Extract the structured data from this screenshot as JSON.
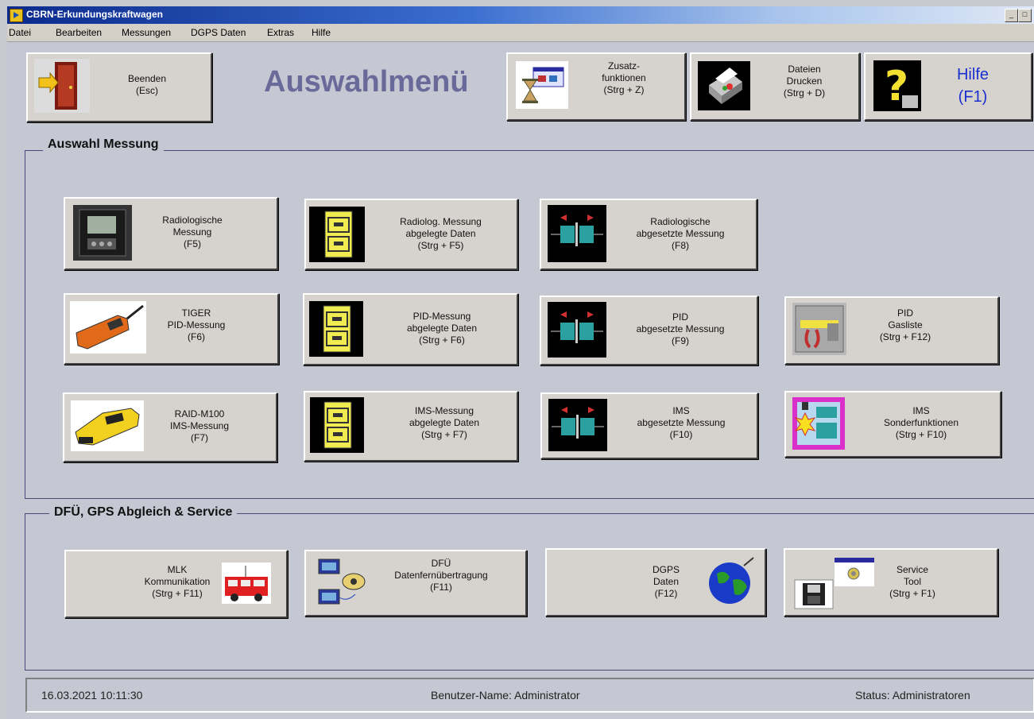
{
  "window": {
    "title": "CBRN-Erkundungskraftwagen"
  },
  "menu": [
    "Datei",
    "Bearbeiten",
    "Messungen",
    "DGPS Daten",
    "Extras",
    "Hilfe"
  ],
  "toolbar": {
    "beenden": "Beenden\n(Esc)",
    "heading": "Auswahlmenü",
    "zusatz": "Zusatz-\nfunktionen\n(Strg + Z)",
    "drucken": "Dateien\nDrucken\n(Strg + D)",
    "hilfe": "Hilfe\n(F1)"
  },
  "auswahl": {
    "title": "Auswahl Messung",
    "buttons": [
      "Radiologische\nMessung\n(F5)",
      "Radiolog. Messung\nabgelegte Daten\n(Strg + F5)",
      "Radiologische\nabgesetzte Messung\n(F8)",
      "TIGER\nPID-Messung\n(F6)",
      "PID-Messung\nabgelegte Daten\n(Strg + F6)",
      "PID\nabgesetzte Messung\n(F9)",
      "PID\nGasliste\n(Strg + F12)",
      "RAID-M100\nIMS-Messung\n(F7)",
      "IMS-Messung\nabgelegte Daten\n(Strg + F7)",
      "IMS\nabgesetzte Messung\n(F10)",
      "IMS\nSonderfunktionen\n(Strg + F10)"
    ]
  },
  "service": {
    "title": "DFÜ, GPS Abgleich & Service",
    "buttons": [
      "MLK\nKommunikation\n(Strg + F11)",
      "DFÜ\nDatenfernübertragung\n(F11)",
      "DGPS\nDaten\n(F12)",
      "Service\nTool\n(Strg + F1)"
    ]
  },
  "status": {
    "datetime": "16.03.2021 10:11:30",
    "user": "Benutzer-Name: Administrator",
    "state": "Status: Administratoren"
  },
  "colors": {
    "heading": "#6a6a9a",
    "help_text": "#1a2fd0",
    "title_bar": "#0a2a8c"
  },
  "icons": [
    "exit-door-icon",
    "hourglass-icon",
    "printer-icon",
    "help-question-icon",
    "dosimeter-photo-icon",
    "file-cabinet-icon",
    "remote-sensor-icon",
    "pid-detector-photo-icon",
    "gas-list-tool-icon",
    "ims-detector-photo-icon",
    "ims-special-icon",
    "vehicle-icon",
    "phone-computer-icon",
    "globe-icon",
    "floppy-disk-icon",
    "service-gear-icon"
  ]
}
